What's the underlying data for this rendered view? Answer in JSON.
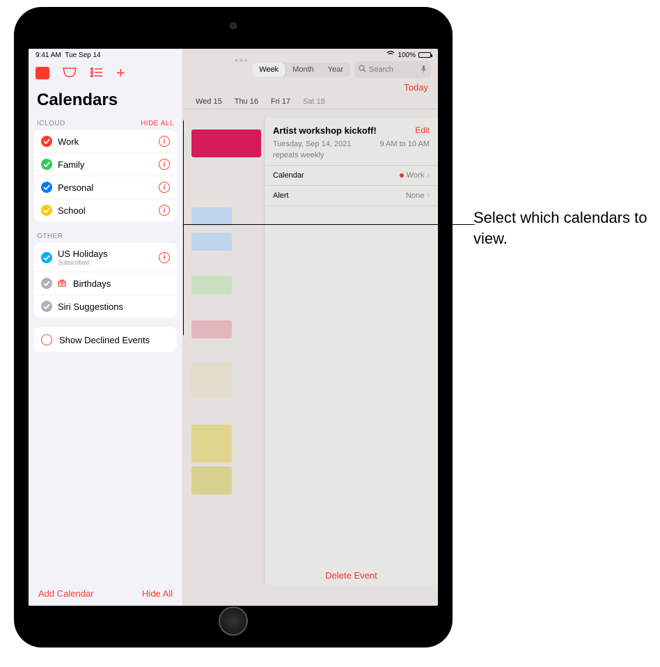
{
  "statusbar": {
    "time": "9:41 AM",
    "date": "Tue Sep 14",
    "battery": "100%"
  },
  "sidebar": {
    "title": "Calendars",
    "section1": {
      "header": "ICLOUD",
      "hide": "HIDE ALL"
    },
    "items": [
      {
        "label": "Work",
        "color": "#ff3b30"
      },
      {
        "label": "Family",
        "color": "#34c759"
      },
      {
        "label": "Personal",
        "color": "#007aff"
      },
      {
        "label": "School",
        "color": "#ffcc00"
      }
    ],
    "section2": {
      "header": "OTHER"
    },
    "other": [
      {
        "label": "US Holidays",
        "sub": "Subscribed",
        "color": "#00b0ff",
        "info": true
      },
      {
        "label": "Birthdays",
        "gift": true,
        "color": "#b0b0b8"
      },
      {
        "label": "Siri Suggestions",
        "color": "#b0b0b8"
      }
    ],
    "declined": "Show Declined Events",
    "footer": {
      "add": "Add Calendar",
      "hide": "Hide All"
    }
  },
  "seg": {
    "week": "Week",
    "month": "Month",
    "year": "Year"
  },
  "search": {
    "placeholder": "Search"
  },
  "today": "Today",
  "days": {
    "wed": "Wed 15",
    "thu": "Thu 16",
    "fri": "Fri 17",
    "sat": "Sat 18"
  },
  "event": {
    "title": "Artist workshop kickoff!",
    "edit": "Edit",
    "date": "Tuesday, Sep 14, 2021",
    "time": "9 AM to 10 AM",
    "repeat": "repeats weekly",
    "calendar_label": "Calendar",
    "calendar_value": "Work",
    "alert_label": "Alert",
    "alert_value": "None",
    "delete": "Delete Event"
  },
  "callout": "Select which calendars to view."
}
